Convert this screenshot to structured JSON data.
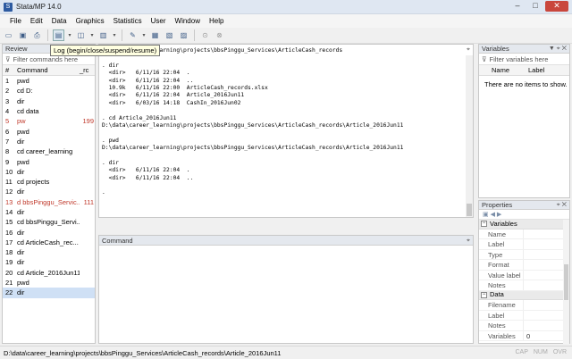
{
  "window": {
    "title": "Stata/MP 14.0",
    "controls": {
      "minimize": "–",
      "maximize": "□",
      "close": "✕"
    }
  },
  "menu": [
    "File",
    "Edit",
    "Data",
    "Graphics",
    "Statistics",
    "User",
    "Window",
    "Help"
  ],
  "toolbar": {
    "tooltip": "Log (begin/close/suspend/resume)",
    "icons": [
      "open-icon",
      "save-icon",
      "print-icon",
      "log-icon",
      "viewer-icon",
      "graph-icon",
      "do-file-editor-icon",
      "data-editor-icon",
      "data-browser-icon",
      "variables-manager-icon",
      "more-icon",
      "break-icon"
    ]
  },
  "review": {
    "title": "Review",
    "filter_placeholder": "Filter commands here",
    "headers": {
      "num": "#",
      "command": "Command",
      "rc": "_rc"
    },
    "rows": [
      {
        "num": "1",
        "command": "pwd",
        "rc": "",
        "error": false
      },
      {
        "num": "2",
        "command": "cd D:",
        "rc": "",
        "error": false
      },
      {
        "num": "3",
        "command": "dir",
        "rc": "",
        "error": false
      },
      {
        "num": "4",
        "command": "cd data",
        "rc": "",
        "error": false
      },
      {
        "num": "5",
        "command": "pw",
        "rc": "199",
        "error": true
      },
      {
        "num": "6",
        "command": "pwd",
        "rc": "",
        "error": false
      },
      {
        "num": "7",
        "command": "dir",
        "rc": "",
        "error": false
      },
      {
        "num": "8",
        "command": "cd career_learning",
        "rc": "",
        "error": false
      },
      {
        "num": "9",
        "command": "pwd",
        "rc": "",
        "error": false
      },
      {
        "num": "10",
        "command": "dir",
        "rc": "",
        "error": false
      },
      {
        "num": "11",
        "command": "cd projects",
        "rc": "",
        "error": false
      },
      {
        "num": "12",
        "command": "dir",
        "rc": "",
        "error": false
      },
      {
        "num": "13",
        "command": "d bbsPinggu_Servic...",
        "rc": "111",
        "error": true
      },
      {
        "num": "14",
        "command": "dir",
        "rc": "",
        "error": false
      },
      {
        "num": "15",
        "command": "cd bbsPinggu_Servi...",
        "rc": "",
        "error": false
      },
      {
        "num": "16",
        "command": "dir",
        "rc": "",
        "error": false
      },
      {
        "num": "17",
        "command": "cd ArticleCash_rec...",
        "rc": "",
        "error": false
      },
      {
        "num": "18",
        "command": "dir",
        "rc": "",
        "error": false
      },
      {
        "num": "19",
        "command": "dir",
        "rc": "",
        "error": false
      },
      {
        "num": "20",
        "command": "cd Article_2016Jun11",
        "rc": "",
        "error": false
      },
      {
        "num": "21",
        "command": "pwd",
        "rc": "",
        "error": false
      },
      {
        "num": "22",
        "command": "dir",
        "rc": "",
        "error": false
      }
    ]
  },
  "results": {
    "lines": [
      "D:\\data\\career_learning\\projects\\bbsPinggu_Services\\ArticleCash_records",
      "",
      ". dir",
      "  <dir>   6/11/16 22:04  .",
      "  <dir>   6/11/16 22:04  ..",
      "  10.9k   6/11/16 22:00  ArticleCash_records.xlsx",
      "  <dir>   6/11/16 22:04  Article_2016Jun11",
      "  <dir>   6/03/16 14:18  CashIn_2016Jun02",
      "",
      ". cd Article_2016Jun11",
      "D:\\data\\career_learning\\projects\\bbsPinggu_Services\\ArticleCash_records\\Article_2016Jun11",
      "",
      ". pwd",
      "D:\\data\\career_learning\\projects\\bbsPinggu_Services\\ArticleCash_records\\Article_2016Jun11",
      "",
      ". dir",
      "  <dir>   6/11/16 22:04  .",
      "  <dir>   6/11/16 22:04  ..",
      "",
      "."
    ]
  },
  "command": {
    "title": "Command"
  },
  "variables": {
    "title": "Variables",
    "filter_placeholder": "Filter variables here",
    "headers": {
      "name": "Name",
      "label": "Label"
    },
    "empty_message": "There are no items to show."
  },
  "properties": {
    "title": "Properties",
    "sections": [
      {
        "name": "Variables",
        "rows": [
          {
            "key": "Name",
            "value": ""
          },
          {
            "key": "Label",
            "value": ""
          },
          {
            "key": "Type",
            "value": ""
          },
          {
            "key": "Format",
            "value": ""
          },
          {
            "key": "Value label",
            "value": ""
          },
          {
            "key": "Notes",
            "value": ""
          }
        ]
      },
      {
        "name": "Data",
        "rows": [
          {
            "key": "Filename",
            "value": ""
          },
          {
            "key": "Label",
            "value": ""
          },
          {
            "key": "Notes",
            "value": ""
          },
          {
            "key": "Variables",
            "value": "0"
          }
        ]
      }
    ]
  },
  "statusbar": {
    "path": "D:\\data\\career_learning\\projects\\bbsPinggu_Services\\ArticleCash_records\\Article_2016Jun11",
    "indicators": [
      "CAP",
      "NUM",
      "OVR"
    ]
  }
}
